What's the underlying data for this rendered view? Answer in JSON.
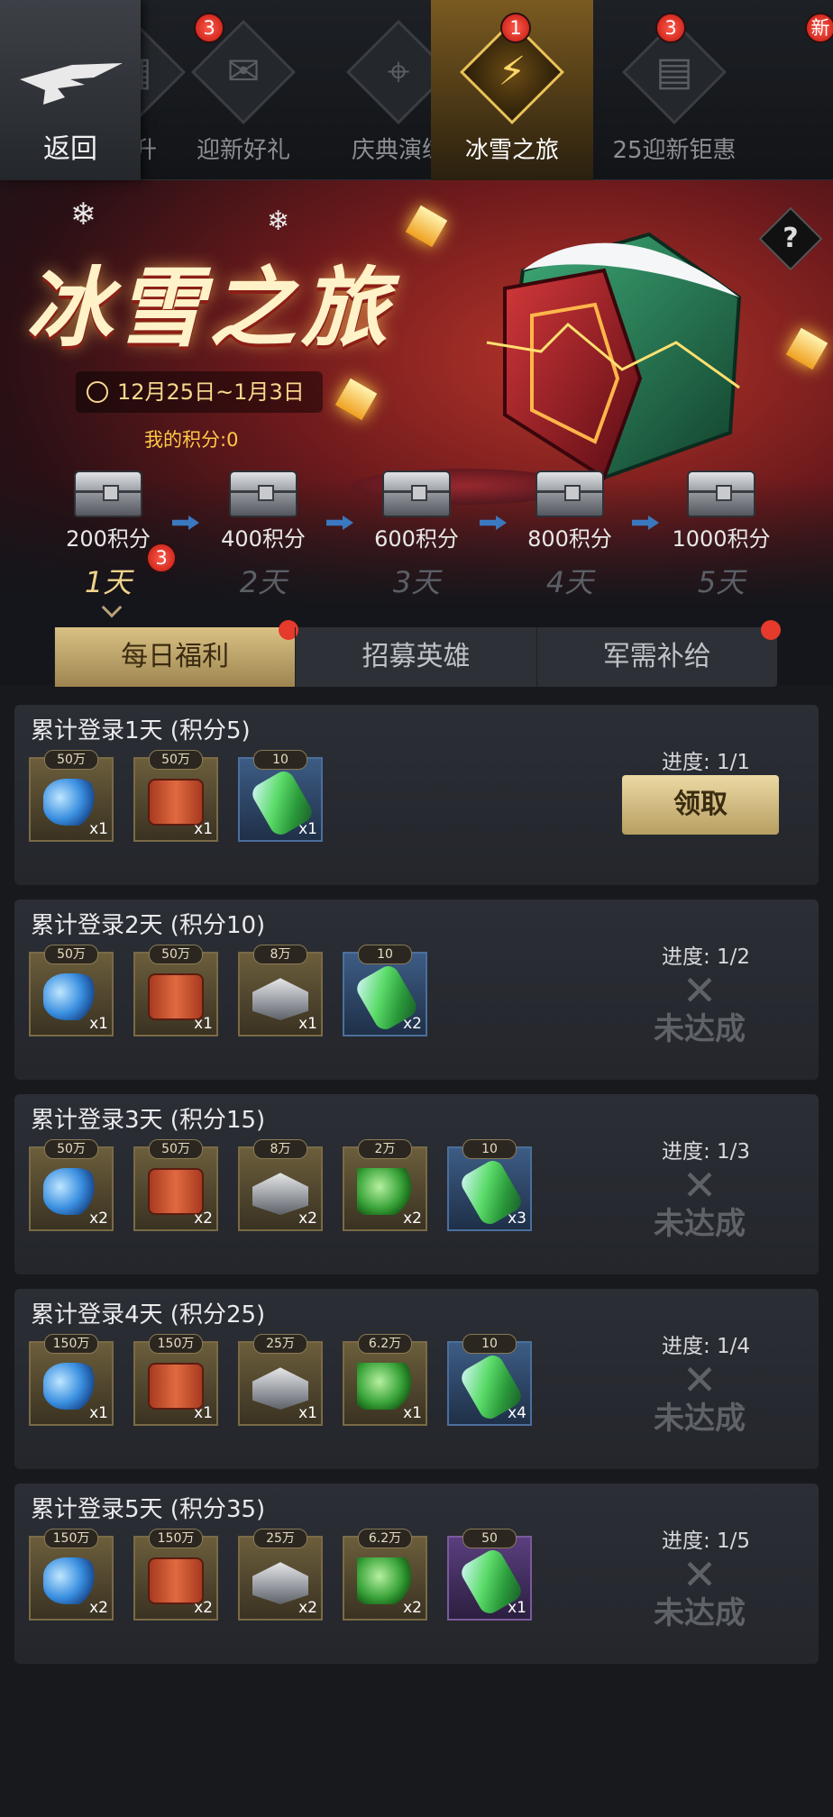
{
  "header": {
    "back_label": "返回",
    "tabs": [
      {
        "label": "高升",
        "icon": "card-icon",
        "glyph": "▦",
        "badge": "3"
      },
      {
        "label": "迎新好礼",
        "icon": "gift-icon",
        "glyph": "✉",
        "badge": "1"
      },
      {
        "label": "庆典演练",
        "icon": "crosshair-icon",
        "glyph": "⌖",
        "badge": ""
      },
      {
        "label": "冰雪之旅",
        "icon": "lightning-icon",
        "glyph": "⚡",
        "badge": "3"
      },
      {
        "label": "25迎新钜惠",
        "icon": "gold-bars-icon",
        "glyph": "▤",
        "badge": "新"
      }
    ]
  },
  "banner": {
    "title": "冰雪之旅",
    "date_range": "12月25日~1月3日",
    "my_points": "我的积分:0",
    "help": "?"
  },
  "milestones": [
    {
      "points": "200积分",
      "day": "1天",
      "badge": "3",
      "active": true
    },
    {
      "points": "400积分",
      "day": "2天"
    },
    {
      "points": "600积分",
      "day": "3天"
    },
    {
      "points": "800积分",
      "day": "4天"
    },
    {
      "points": "1000积分",
      "day": "5天"
    }
  ],
  "subtabs": [
    {
      "label": "每日福利",
      "dot": true,
      "active": true
    },
    {
      "label": "招募英雄",
      "dot": false
    },
    {
      "label": "军需补给",
      "dot": true
    }
  ],
  "tasks": [
    {
      "title": "累计登录1天 (积分5)",
      "progress": "进度: 1/1",
      "status": "claim",
      "status_label": "领取",
      "items": [
        {
          "type": "crystal",
          "tag": "50万",
          "qty": "x1",
          "frame": "gold"
        },
        {
          "type": "oil",
          "tag": "50万",
          "qty": "x1",
          "frame": "gold"
        },
        {
          "type": "battery",
          "tag": "10",
          "qty": "x1",
          "frame": "blue"
        }
      ]
    },
    {
      "title": "累计登录2天 (积分10)",
      "progress": "进度: 1/2",
      "status": "unmet",
      "status_label": "未达成",
      "items": [
        {
          "type": "crystal",
          "tag": "50万",
          "qty": "x1",
          "frame": "gold"
        },
        {
          "type": "oil",
          "tag": "50万",
          "qty": "x1",
          "frame": "gold"
        },
        {
          "type": "steel",
          "tag": "8万",
          "qty": "x1",
          "frame": "gold"
        },
        {
          "type": "battery",
          "tag": "10",
          "qty": "x2",
          "frame": "blue"
        }
      ]
    },
    {
      "title": "累计登录3天 (积分15)",
      "progress": "进度: 1/3",
      "status": "unmet",
      "status_label": "未达成",
      "items": [
        {
          "type": "crystal",
          "tag": "50万",
          "qty": "x2",
          "frame": "gold"
        },
        {
          "type": "oil",
          "tag": "50万",
          "qty": "x2",
          "frame": "gold"
        },
        {
          "type": "steel",
          "tag": "8万",
          "qty": "x2",
          "frame": "gold"
        },
        {
          "type": "cash",
          "tag": "2万",
          "qty": "x2",
          "frame": "gold"
        },
        {
          "type": "battery",
          "tag": "10",
          "qty": "x3",
          "frame": "blue"
        }
      ]
    },
    {
      "title": "累计登录4天 (积分25)",
      "progress": "进度: 1/4",
      "status": "unmet",
      "status_label": "未达成",
      "items": [
        {
          "type": "crystal",
          "tag": "150万",
          "qty": "x1",
          "frame": "gold"
        },
        {
          "type": "oil",
          "tag": "150万",
          "qty": "x1",
          "frame": "gold"
        },
        {
          "type": "steel",
          "tag": "25万",
          "qty": "x1",
          "frame": "gold"
        },
        {
          "type": "cash",
          "tag": "6.2万",
          "qty": "x1",
          "frame": "gold"
        },
        {
          "type": "battery",
          "tag": "10",
          "qty": "x4",
          "frame": "blue"
        }
      ]
    },
    {
      "title": "累计登录5天 (积分35)",
      "progress": "进度: 1/5",
      "status": "unmet",
      "status_label": "未达成",
      "items": [
        {
          "type": "crystal",
          "tag": "150万",
          "qty": "x2",
          "frame": "gold"
        },
        {
          "type": "oil",
          "tag": "150万",
          "qty": "x2",
          "frame": "gold"
        },
        {
          "type": "steel",
          "tag": "25万",
          "qty": "x2",
          "frame": "gold"
        },
        {
          "type": "cash",
          "tag": "6.2万",
          "qty": "x2",
          "frame": "gold"
        },
        {
          "type": "battery",
          "tag": "50",
          "qty": "x1",
          "frame": "purple"
        }
      ]
    }
  ]
}
